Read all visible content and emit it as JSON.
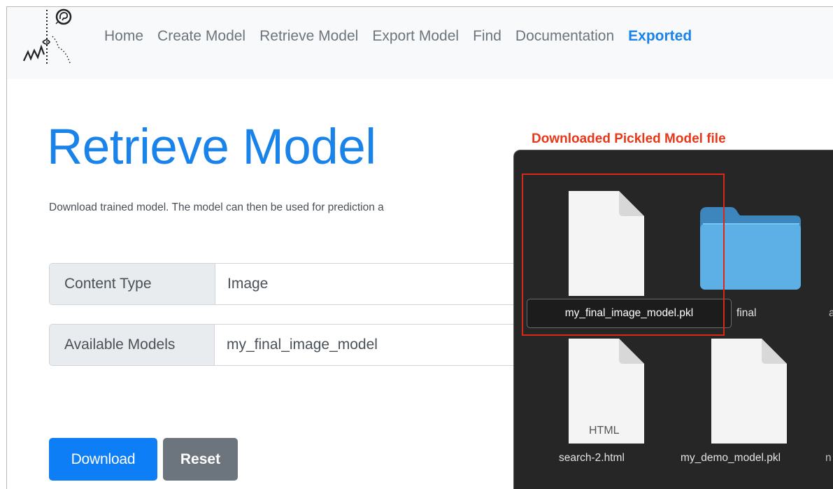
{
  "nav": {
    "links": [
      "Home",
      "Create Model",
      "Retrieve Model",
      "Export Model",
      "Find",
      "Documentation"
    ],
    "active": "Exported"
  },
  "main": {
    "title": "Retrieve Model",
    "lead": "Download trained model. The model can then be used for prediction a",
    "content_type": {
      "label": "Content Type",
      "value": "Image"
    },
    "available_models": {
      "label": "Available Models",
      "value": "my_final_image_model"
    },
    "download_label": "Download",
    "reset_label": "Reset"
  },
  "annotation": "Downloaded Pickled Model file",
  "finder": {
    "selected_file": "my_final_image_model.pkl",
    "folder_name": "final",
    "html_doc_tag": "HTML",
    "files": [
      "search-2.html",
      "my_demo_model.pkl"
    ],
    "partial_labels": [
      "a",
      "n"
    ]
  },
  "colors": {
    "brand_blue": "#1a83ea",
    "annotation_red": "#e8381a",
    "finder_bg": "#262626"
  }
}
